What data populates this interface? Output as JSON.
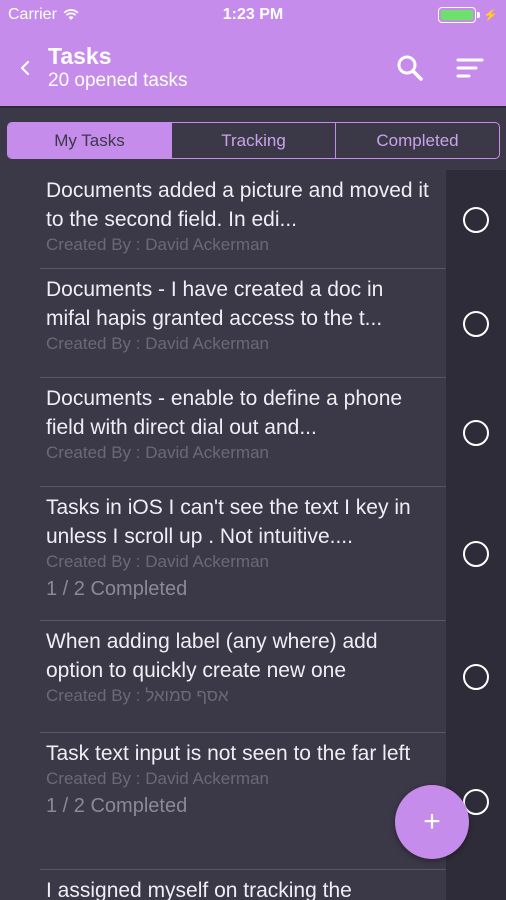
{
  "status_bar": {
    "carrier": "Carrier",
    "time": "1:23 PM",
    "battery": "full"
  },
  "nav": {
    "title": "Tasks",
    "subtitle": "20 opened tasks",
    "icons": [
      "back-icon",
      "search-icon",
      "sort-icon"
    ]
  },
  "tabs": [
    {
      "label": "My Tasks",
      "active": true
    },
    {
      "label": "Tracking",
      "active": false
    },
    {
      "label": "Completed",
      "active": false
    }
  ],
  "tasks": [
    {
      "title": "Documents added a picture and moved it to the second field. In edi...",
      "creator": "Created By : David Ackerman",
      "progress": ""
    },
    {
      "title": "Documents - I have created a doc in mifal hapis granted access to the t...",
      "creator": "Created By : David Ackerman",
      "progress": ""
    },
    {
      "title": "Documents - enable to define a phone field with direct dial out and...",
      "creator": "Created By : David Ackerman",
      "progress": ""
    },
    {
      "title": "Tasks in iOS I can't see the text I key in unless I scroll up . Not intuitive....",
      "creator": "Created By : David Ackerman",
      "progress": "1 / 2 Completed"
    },
    {
      "title": "When adding label (any where) add option to quickly create new one",
      "creator": "Created By : אסף סמואל",
      "progress": ""
    },
    {
      "title": "Task text input is not seen to the far left",
      "creator": "Created By : David Ackerman",
      "progress": "1 / 2 Completed"
    },
    {
      "title": "I assigned myself on tracking the",
      "creator": "",
      "progress": ""
    }
  ],
  "fab": {
    "label": "+"
  },
  "colors": {
    "accent": "#c68cec",
    "background": "#3b3847",
    "check_column": "#2f2c39"
  }
}
